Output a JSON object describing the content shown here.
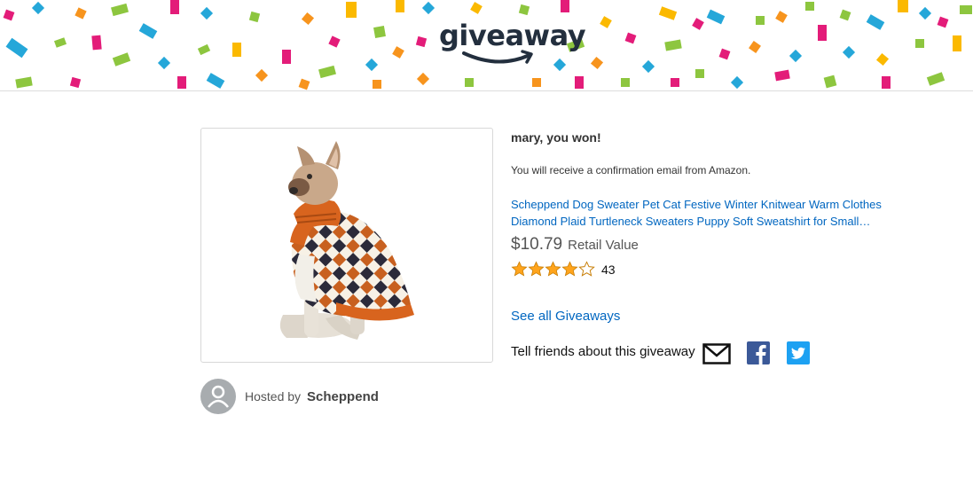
{
  "header": {
    "logo_text": "giveaway",
    "confetti_colors": [
      "#e31c79",
      "#25a7d9",
      "#8dc63f",
      "#f7941d",
      "#fbb900"
    ]
  },
  "prize": {
    "image_alt": "Dog wearing orange argyle turtleneck sweater",
    "winner_message": "mary, you won!",
    "confirmation_text": "You will receive a confirmation email from Amazon.",
    "product_title": "Scheppend Dog Sweater Pet Cat Festive Winter Knitwear Warm Clothes Diamond Plaid Turtleneck Sweaters Puppy Soft Sweatshirt for Small…",
    "price": "$10.79",
    "price_label": "Retail Value",
    "rating": 4.0,
    "rating_max": 5,
    "review_count": "43"
  },
  "host": {
    "label": "Hosted by",
    "name": "Scheppend",
    "avatar_icon": "default-user-avatar-icon"
  },
  "links": {
    "see_all": "See all Giveaways"
  },
  "share": {
    "label": "Tell friends about this giveaway",
    "icons": [
      "email-icon",
      "facebook-icon",
      "twitter-icon"
    ],
    "facebook_color": "#3b5998",
    "twitter_color": "#1da1f2"
  },
  "colors": {
    "link": "#0066c0",
    "star_fill": "#ffa41c",
    "brand_dark": "#232f3e"
  }
}
